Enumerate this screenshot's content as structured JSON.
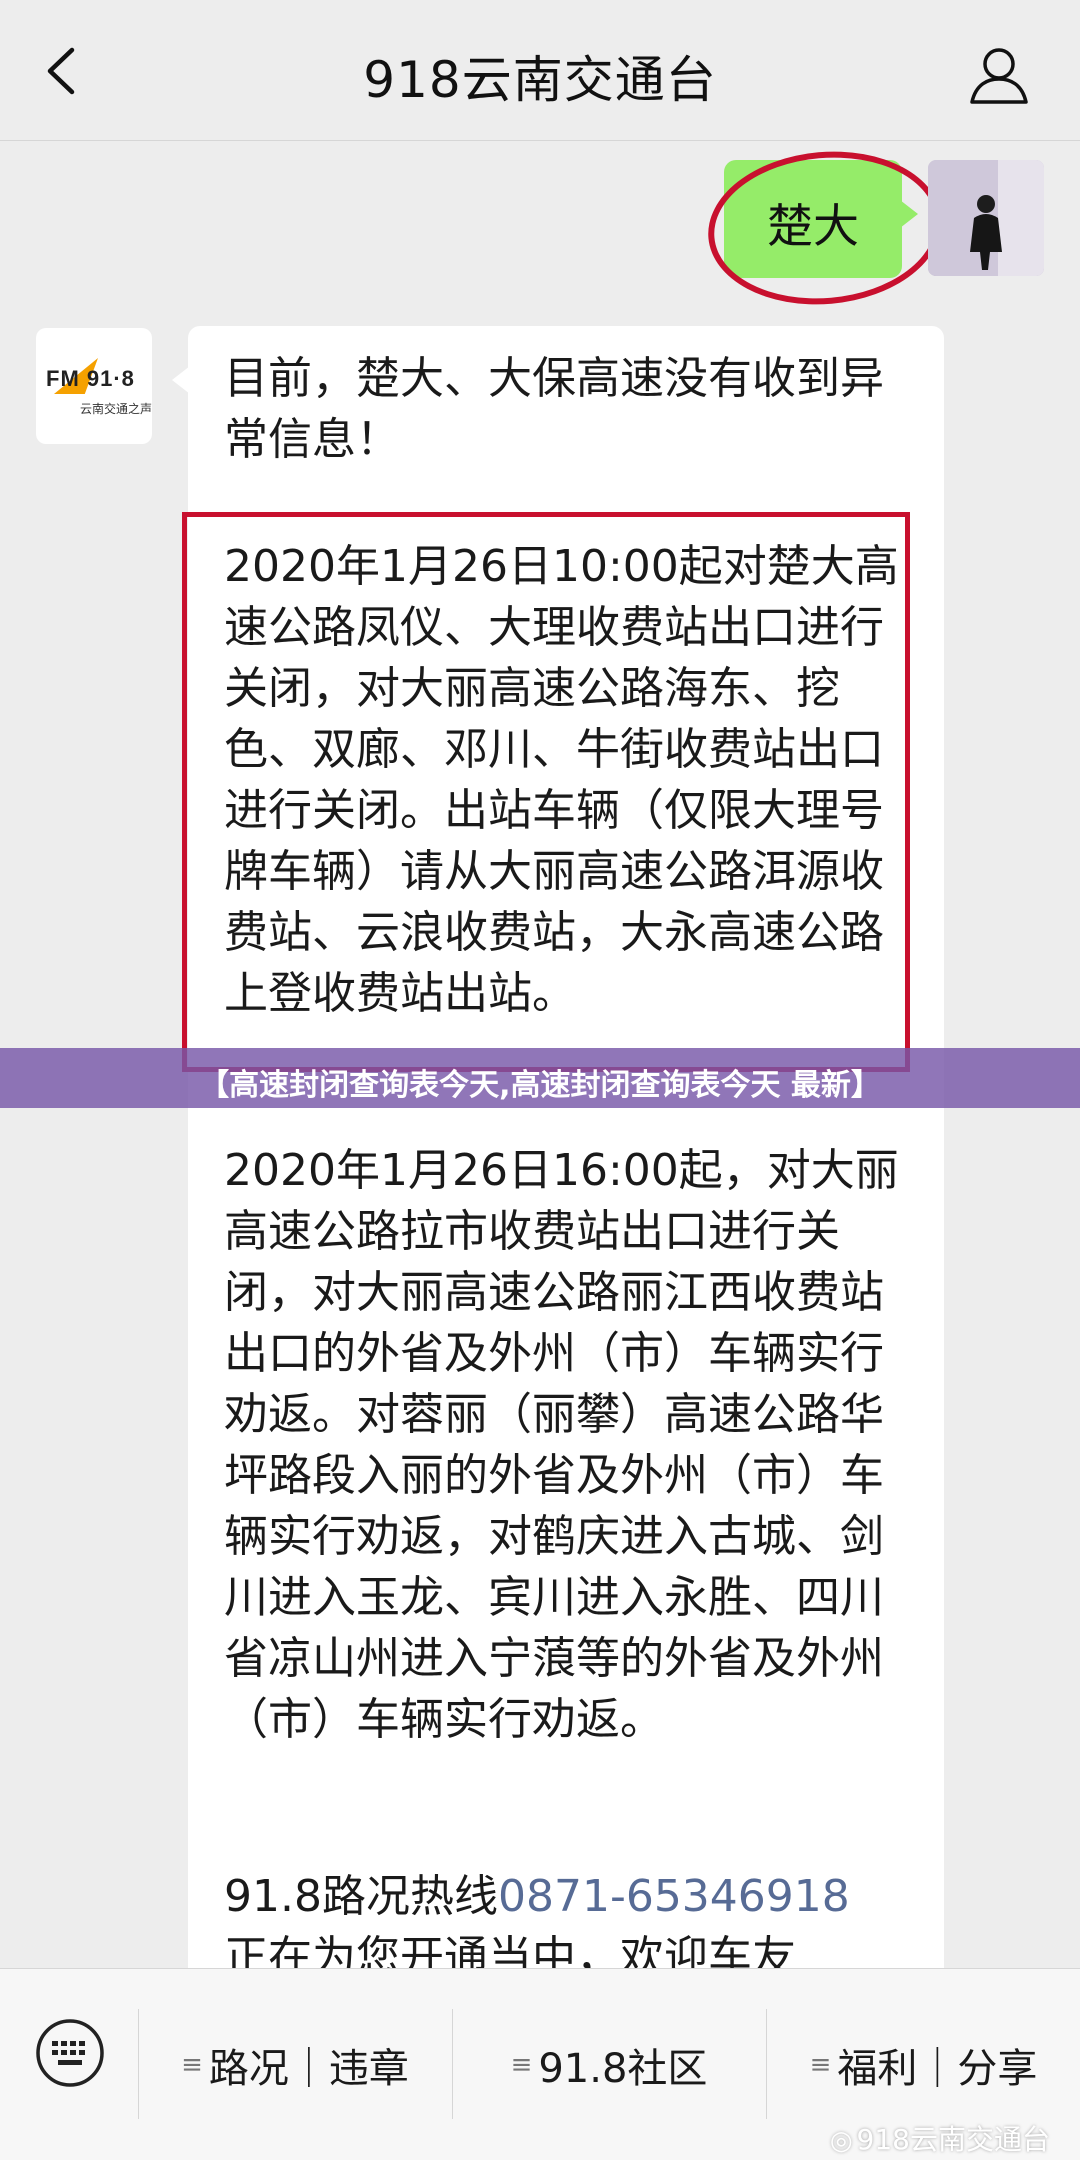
{
  "header": {
    "title": "918云南交通台"
  },
  "sent_message": {
    "text": "楚大"
  },
  "received_message": {
    "intro": "目前，楚大、大保高速没有收到异常信息！",
    "notice_1": "2020年1月26日10:00起对楚大高速公路凤仪、大理收费站出口进行关闭，对大丽高速公路海东、挖色、双廊、邓川、牛街收费站出口进行关闭。出站车辆（仅限大理号牌车辆）请从大丽高速公路洱源收费站、云浪收费站，大永高速公路上登收费站出站。",
    "notice_2": "2020年1月26日16:00起，对大丽高速公路拉市收费站出口进行关闭，对大丽高速公路丽江西收费站出口的外省及外州（市）车辆实行劝返。对蓉丽（丽攀）高速公路华坪路段入丽的外省及外州（市）车辆实行劝返，对鹤庆进入古城、剑川进入玉龙、宾川进入永胜、四川省凉山州进入宁蒗等的外省及外州（市）车辆实行劝返。",
    "hotline_label": "91.8路况热线",
    "hotline_number": "0871-65346918",
    "hotline_cont": "正在为您开通当中，欢迎车友"
  },
  "overlay": {
    "title": "【高速封闭查询表今天,高速封闭查询表今天 最新】"
  },
  "bottom_menu": {
    "items": [
      {
        "label": "路况｜违章"
      },
      {
        "label": "91.8社区"
      },
      {
        "label": "福利｜分享"
      }
    ],
    "menu_marker": "≡"
  },
  "watermark": {
    "text": "918云南交通台"
  },
  "colors": {
    "sent_bubble": "#95ec69",
    "highlight_red": "#c8102e",
    "link_blue": "#576b95",
    "overlay_purple": "#7858a8"
  }
}
